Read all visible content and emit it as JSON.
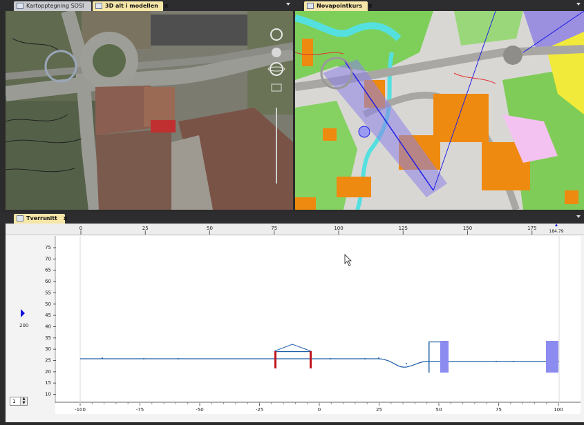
{
  "panes": {
    "left": {
      "tabs": [
        {
          "label": "Kartopptegning SOSI",
          "active": false
        },
        {
          "label": "3D alt i modellen",
          "active": true
        }
      ],
      "close_glyph": "x"
    },
    "right": {
      "tabs": [
        {
          "label": "Novapointkurs",
          "active": true
        }
      ],
      "close_glyph": "x"
    },
    "bottom": {
      "tabs": [
        {
          "label": "Tverrsnitt",
          "active": true
        }
      ],
      "close_glyph": "x"
    }
  },
  "cross_section": {
    "station_ruler": {
      "ticks": [
        "0",
        "25",
        "50",
        "75",
        "100",
        "125",
        "150",
        "175"
      ],
      "marker_label": "184.79"
    },
    "elevation_labels": [
      "75",
      "70",
      "65",
      "60",
      "55",
      "50",
      "45",
      "40",
      "35",
      "30",
      "25",
      "20",
      "15",
      "10"
    ],
    "offset_labels": [
      "-100",
      "-75",
      "-50",
      "-25",
      "0",
      "25",
      "50",
      "75",
      "100"
    ],
    "scale_value": "200",
    "stepper_value": "1",
    "colors": {
      "terrain_line": "#1f5fa8",
      "culvert_walls": "#c0151b",
      "structure_fill": "#8b8bf0",
      "panel_bg": "#f3f3f3"
    }
  },
  "icons": {
    "tab_icon": "window-icon",
    "marker": "blue-triangle-icon",
    "cursor": "mouse-pointer-icon"
  }
}
